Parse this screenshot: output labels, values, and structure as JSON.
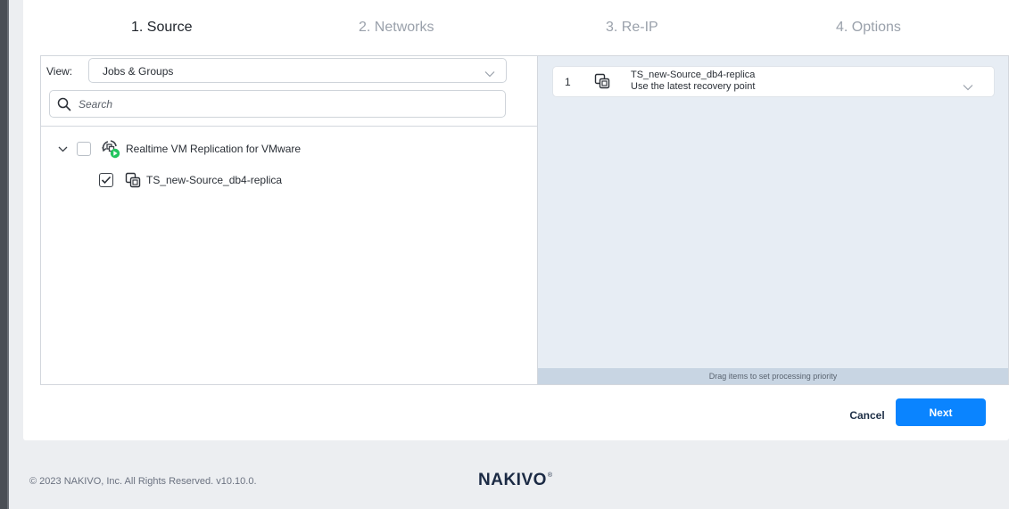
{
  "steps": [
    {
      "label": "1. Source",
      "active": true
    },
    {
      "label": "2. Networks",
      "active": false
    },
    {
      "label": "3. Re-IP",
      "active": false
    },
    {
      "label": "4. Options",
      "active": false
    }
  ],
  "source_panel": {
    "view_label": "View:",
    "view_value": "Jobs & Groups",
    "search_placeholder": "Search",
    "tree": [
      {
        "label": "Realtime VM Replication for VMware",
        "checked": false,
        "expanded": true,
        "icon": "replication-job-icon"
      },
      {
        "label": "TS_new-Source_db4-replica",
        "checked": true,
        "icon": "vm-replica-icon"
      }
    ]
  },
  "selected_panel": {
    "items": [
      {
        "index": "1",
        "name": "TS_new-Source_db4-replica",
        "recovery_point": "Use the latest recovery point",
        "icon": "vm-replica-icon"
      }
    ],
    "hint": "Drag items to set processing priority"
  },
  "buttons": {
    "cancel": "Cancel",
    "next": "Next"
  },
  "footer": {
    "copyright": "© 2023 NAKIVO, Inc. All Rights Reserved. v10.10.0.",
    "logo": "NAKIVO",
    "logo_mark": "®"
  },
  "colors": {
    "accent": "#0a84ff",
    "status_running": "#22c55e",
    "selected_panel_bg": "#e7edf4"
  }
}
